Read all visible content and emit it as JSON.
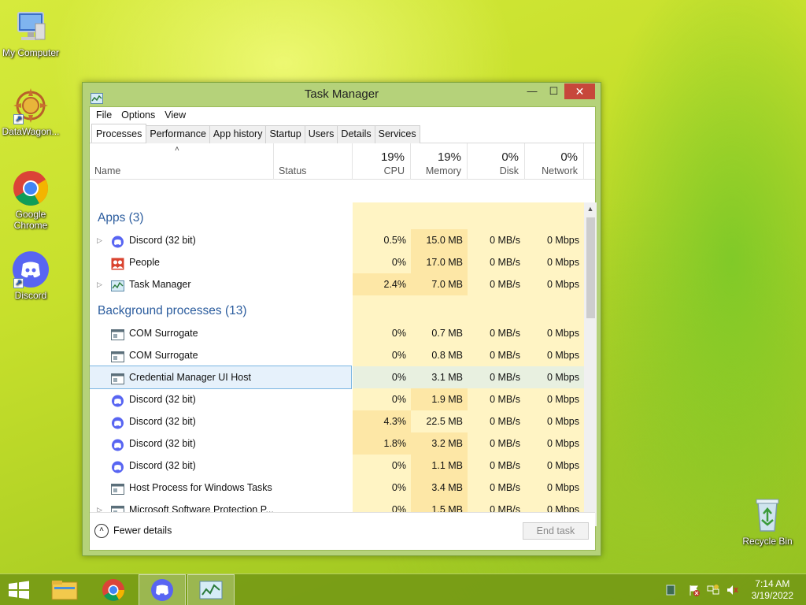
{
  "desktop": {
    "icons": [
      {
        "label": "My Computer",
        "icon": "computer-icon"
      },
      {
        "label": "DataWagon...",
        "icon": "datawagon-icon"
      },
      {
        "label": "Google Chrome",
        "icon": "chrome-icon"
      },
      {
        "label": "Discord",
        "icon": "discord-icon"
      },
      {
        "label": "Recycle Bin",
        "icon": "recycle-bin-icon"
      }
    ]
  },
  "window": {
    "title": "Task Manager",
    "min_glyph": "—",
    "max_glyph": "☐",
    "close_glyph": "✕",
    "menu": [
      "File",
      "Options",
      "View"
    ],
    "tabs": [
      "Processes",
      "Performance",
      "App history",
      "Startup",
      "Users",
      "Details",
      "Services"
    ],
    "active_tab": "Processes",
    "columns": {
      "name": "Name",
      "status": "Status",
      "cpu": {
        "pct": "19%",
        "label": "CPU"
      },
      "memory": {
        "pct": "19%",
        "label": "Memory"
      },
      "disk": {
        "pct": "0%",
        "label": "Disk"
      },
      "network": {
        "pct": "0%",
        "label": "Network"
      }
    },
    "rows": [
      {
        "type": "group",
        "name": "Apps (3)"
      },
      {
        "type": "proc",
        "name": "Discord (32 bit)",
        "icon": "discord-icon",
        "expandable": true,
        "cpu": "0.5%",
        "mem": "15.0 MB",
        "disk": "0 MB/s",
        "net": "0 Mbps"
      },
      {
        "type": "proc",
        "name": "People",
        "icon": "people-icon",
        "expandable": false,
        "cpu": "0%",
        "mem": "17.0 MB",
        "disk": "0 MB/s",
        "net": "0 Mbps"
      },
      {
        "type": "proc",
        "name": "Task Manager",
        "icon": "task-manager-icon",
        "expandable": true,
        "cpu": "2.4%",
        "mem": "7.0 MB",
        "disk": "0 MB/s",
        "net": "0 Mbps"
      },
      {
        "type": "group",
        "name": "Background processes (13)"
      },
      {
        "type": "proc",
        "name": "COM Surrogate",
        "icon": "process-icon",
        "expandable": false,
        "cpu": "0%",
        "mem": "0.7 MB",
        "disk": "0 MB/s",
        "net": "0 Mbps"
      },
      {
        "type": "proc",
        "name": "COM Surrogate",
        "icon": "process-icon",
        "expandable": false,
        "cpu": "0%",
        "mem": "0.8 MB",
        "disk": "0 MB/s",
        "net": "0 Mbps"
      },
      {
        "type": "proc",
        "name": "Credential Manager UI Host",
        "icon": "process-icon",
        "expandable": false,
        "selected": true,
        "cpu": "0%",
        "mem": "3.1 MB",
        "disk": "0 MB/s",
        "net": "0 Mbps"
      },
      {
        "type": "proc",
        "name": "Discord (32 bit)",
        "icon": "discord-icon",
        "expandable": false,
        "cpu": "0%",
        "mem": "1.9 MB",
        "disk": "0 MB/s",
        "net": "0 Mbps"
      },
      {
        "type": "proc",
        "name": "Discord (32 bit)",
        "icon": "discord-icon",
        "expandable": false,
        "cpu": "4.3%",
        "mem": "22.5 MB",
        "disk": "0 MB/s",
        "net": "0 Mbps"
      },
      {
        "type": "proc",
        "name": "Discord (32 bit)",
        "icon": "discord-icon",
        "expandable": false,
        "cpu": "1.8%",
        "mem": "3.2 MB",
        "disk": "0 MB/s",
        "net": "0 Mbps"
      },
      {
        "type": "proc",
        "name": "Discord (32 bit)",
        "icon": "discord-icon",
        "expandable": false,
        "cpu": "0%",
        "mem": "1.1 MB",
        "disk": "0 MB/s",
        "net": "0 Mbps"
      },
      {
        "type": "proc",
        "name": "Host Process for Windows Tasks",
        "icon": "process-icon",
        "expandable": false,
        "cpu": "0%",
        "mem": "3.4 MB",
        "disk": "0 MB/s",
        "net": "0 Mbps"
      },
      {
        "type": "proc",
        "name": "Microsoft Software Protection P...",
        "icon": "process-icon",
        "expandable": true,
        "cpu": "0%",
        "mem": "1.5 MB",
        "disk": "0 MB/s",
        "net": "0 Mbps"
      }
    ],
    "footer": {
      "fewer_details": "Fewer details",
      "end_task": "End task"
    }
  },
  "taskbar": {
    "buttons": [
      "start-icon",
      "file-explorer-icon",
      "chrome-icon",
      "discord-icon",
      "task-manager-icon"
    ],
    "time": "7:14 AM",
    "date": "3/19/2022"
  },
  "colors": {
    "heat_light": "#fff4c4",
    "heat_mid": "#fde7a6",
    "group_text": "#2c5d9e",
    "discord": "#5865f2",
    "close": "#c7473b"
  }
}
